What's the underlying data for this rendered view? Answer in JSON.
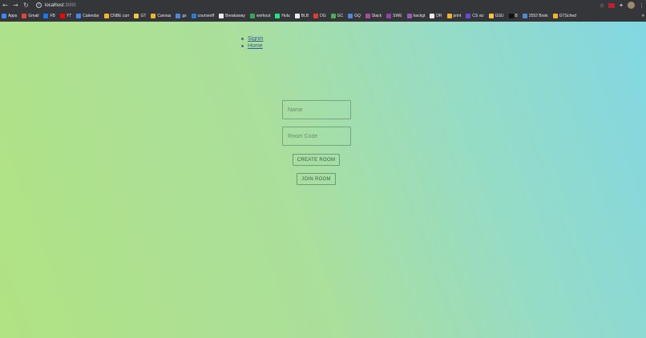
{
  "browser": {
    "url_host": "localhost",
    "url_port": ":3000",
    "bookmarks": [
      {
        "label": "Apps",
        "color": "#4285f4"
      },
      {
        "label": "Gmail",
        "color": "#ea4335"
      },
      {
        "label": "FB",
        "color": "#1877f2"
      },
      {
        "label": "YT",
        "color": "#ff0000"
      },
      {
        "label": "Calendar",
        "color": "#4285f4"
      },
      {
        "label": "CNBE curr",
        "color": "#f0b429"
      },
      {
        "label": "GT",
        "color": "#f4c542"
      },
      {
        "label": "Canvas",
        "color": "#f0b429"
      },
      {
        "label": "gs",
        "color": "#4a8ad8"
      },
      {
        "label": "courseoff",
        "color": "#2a7ad8"
      },
      {
        "label": "Breakaway",
        "color": "#e8eaed"
      },
      {
        "label": "workout",
        "color": "#34a853"
      },
      {
        "label": "Hulu",
        "color": "#1ce783"
      },
      {
        "label": "BLB",
        "color": "#e8eaed"
      },
      {
        "label": "DG",
        "color": "#e53935"
      },
      {
        "label": "GC",
        "color": "#4caf50"
      },
      {
        "label": "GQ",
        "color": "#4a8ad8"
      },
      {
        "label": "Slack",
        "color": "#a84ea0"
      },
      {
        "label": "SWE",
        "color": "#8e44ad"
      },
      {
        "label": "hackgt",
        "color": "#9b59b6"
      },
      {
        "label": "DR",
        "color": "#e8eaed"
      },
      {
        "label": "print",
        "color": "#f0b429"
      },
      {
        "label": "CS viz",
        "color": "#6a4ad8"
      },
      {
        "label": "GSU",
        "color": "#f4c542"
      },
      {
        "label": "B",
        "color": "#111111"
      },
      {
        "label": "2552 Book",
        "color": "#4a8ad8"
      },
      {
        "label": "GTSched",
        "color": "#f0b429"
      }
    ],
    "more": "»"
  },
  "nav": {
    "signin": "Signin",
    "home": "Home"
  },
  "form": {
    "name_placeholder": "Name",
    "room_placeholder": "Room Code",
    "create_label": "CREATE ROOM",
    "join_label": "JOIN ROOM"
  }
}
